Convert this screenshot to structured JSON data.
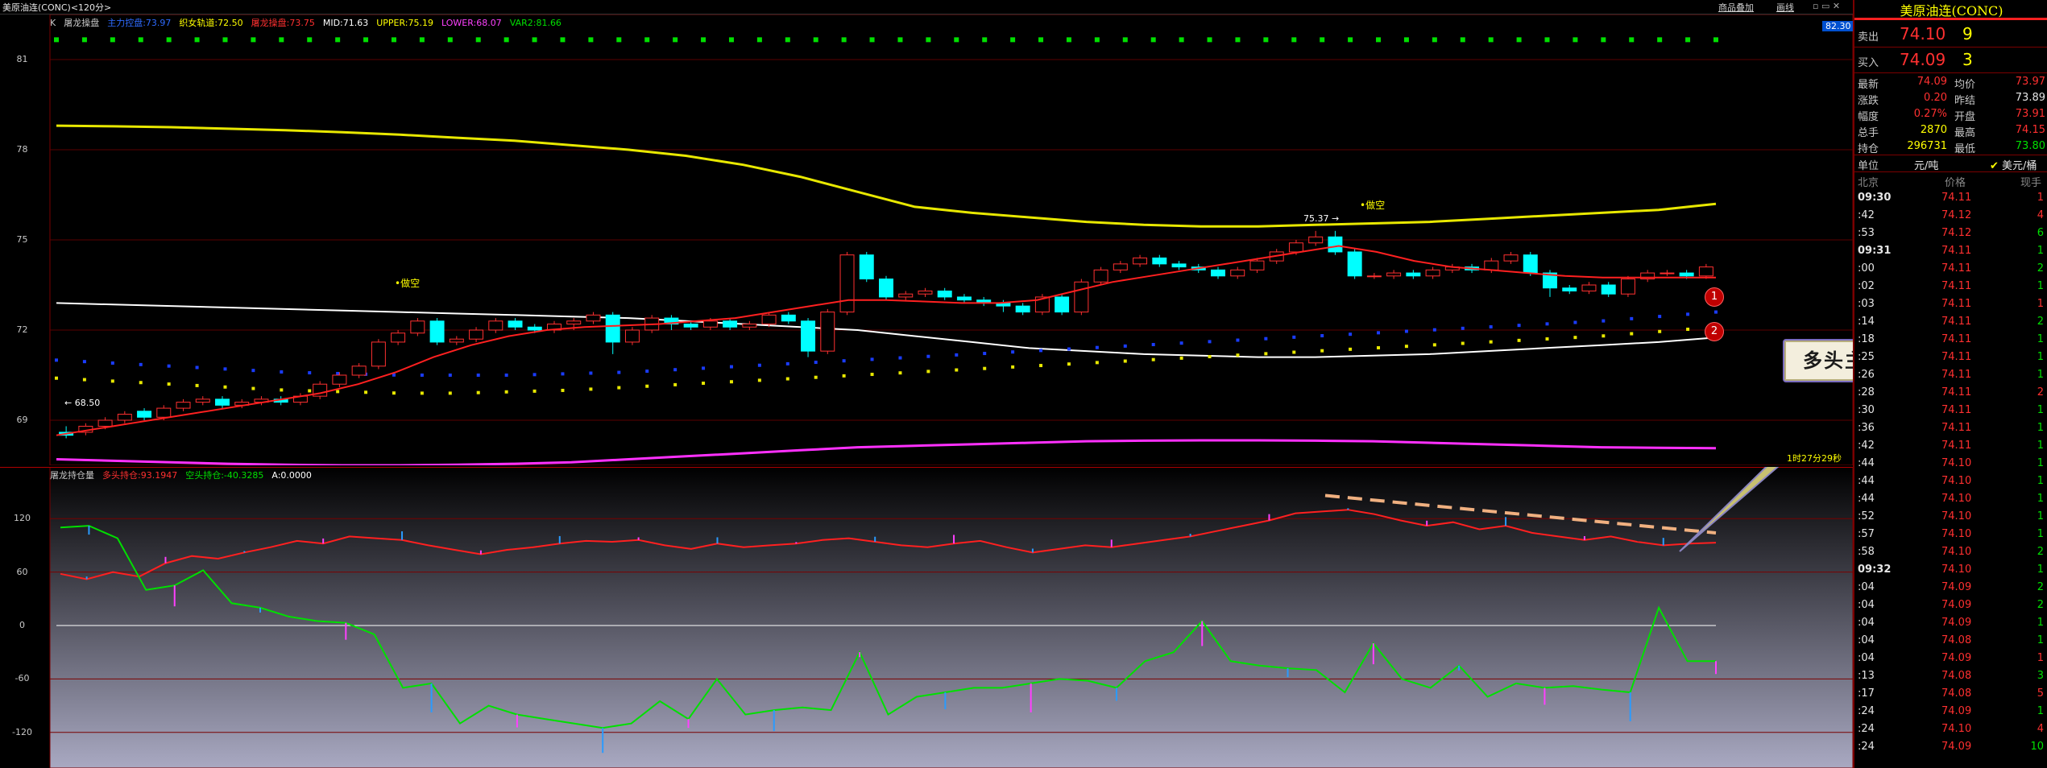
{
  "window": {
    "title": "美原油连(CONC)<120分>",
    "menu": [
      "商品叠加",
      "画线"
    ],
    "timer": "1时27分29秒"
  },
  "main_panel": {
    "legend": [
      {
        "text": "K",
        "color": "#c8c8c8"
      },
      {
        "text": "屠龙操盘",
        "color": "#c8c8c8"
      },
      {
        "text": "主力控盘:73.97",
        "color": "#2e6bff"
      },
      {
        "text": "织女轨道:72.50",
        "color": "#ffff00"
      },
      {
        "text": "屠龙操盘:73.75",
        "color": "#ff3030"
      },
      {
        "text": "MID:71.63",
        "color": "#ffffff"
      },
      {
        "text": "UPPER:75.19",
        "color": "#ffff00"
      },
      {
        "text": "LOWER:68.07",
        "color": "#ff40ff"
      },
      {
        "text": "VAR2:81.66",
        "color": "#00e000"
      }
    ],
    "yticks": [
      "81",
      "78",
      "75",
      "72",
      "69"
    ],
    "price_badge": "82.30",
    "annotations": {
      "high": "75.37",
      "low": "68.50",
      "signal": "做空"
    }
  },
  "sub_panel": {
    "legend": [
      {
        "text": "屠龙持仓量",
        "color": "#c8c8c8"
      },
      {
        "text": "多头持仓:93.1947",
        "color": "#ff3030"
      },
      {
        "text": "空头持仓:-40.3285",
        "color": "#00e000"
      },
      {
        "text": "A:0.0000",
        "color": "#ffffff"
      }
    ],
    "yticks": [
      "120",
      "60",
      "0",
      "-60",
      "-120"
    ]
  },
  "callout": "多头主力拉高出货动作",
  "badges": [
    "1",
    "2"
  ],
  "quote": {
    "title": "美原油连(CONC)",
    "sell_label": "卖出",
    "sell_price": "74.10",
    "sell_vol": "9",
    "buy_label": "买入",
    "buy_price": "74.09",
    "buy_vol": "3",
    "stats": [
      {
        "l1": "最新",
        "v1": "74.09",
        "c1": "red",
        "l2": "均价",
        "v2": "73.97",
        "c2": "red"
      },
      {
        "l1": "涨跌",
        "v1": "0.20",
        "c1": "red",
        "l2": "昨结",
        "v2": "73.89",
        "c2": "wht"
      },
      {
        "l1": "幅度",
        "v1": "0.27%",
        "c1": "red",
        "l2": "开盘",
        "v2": "73.91",
        "c2": "red"
      },
      {
        "l1": "总手",
        "v1": "2870",
        "c1": "yel",
        "l2": "最高",
        "v2": "74.15",
        "c2": "red"
      },
      {
        "l1": "持仓",
        "v1": "296731",
        "c1": "yel",
        "l2": "最低",
        "v2": "73.80",
        "c2": "green"
      }
    ],
    "unit_label": "单位",
    "unit_value": "元/吨",
    "unit_option": "美元/桶",
    "tick_headers": [
      "北京",
      "价格",
      "现手"
    ],
    "ticks": [
      {
        "t": "09:30",
        "p": "74.11",
        "v": "1",
        "pc": "red",
        "vc": "red"
      },
      {
        "t": ":42",
        "p": "74.12",
        "v": "4",
        "pc": "red",
        "vc": "red"
      },
      {
        "t": ":53",
        "p": "74.12",
        "v": "6",
        "pc": "red",
        "vc": "green"
      },
      {
        "t": "09:31",
        "p": "74.11",
        "v": "1",
        "pc": "red",
        "vc": "green"
      },
      {
        "t": ":00",
        "p": "74.11",
        "v": "2",
        "pc": "red",
        "vc": "green"
      },
      {
        "t": ":02",
        "p": "74.11",
        "v": "1",
        "pc": "red",
        "vc": "green"
      },
      {
        "t": ":03",
        "p": "74.11",
        "v": "1",
        "pc": "red",
        "vc": "red"
      },
      {
        "t": ":14",
        "p": "74.11",
        "v": "2",
        "pc": "red",
        "vc": "green"
      },
      {
        "t": ":18",
        "p": "74.11",
        "v": "1",
        "pc": "red",
        "vc": "green"
      },
      {
        "t": ":25",
        "p": "74.11",
        "v": "1",
        "pc": "red",
        "vc": "green"
      },
      {
        "t": ":26",
        "p": "74.11",
        "v": "1",
        "pc": "red",
        "vc": "green"
      },
      {
        "t": ":28",
        "p": "74.11",
        "v": "2",
        "pc": "red",
        "vc": "red"
      },
      {
        "t": ":30",
        "p": "74.11",
        "v": "1",
        "pc": "red",
        "vc": "green"
      },
      {
        "t": ":36",
        "p": "74.11",
        "v": "1",
        "pc": "red",
        "vc": "green"
      },
      {
        "t": ":42",
        "p": "74.11",
        "v": "1",
        "pc": "red",
        "vc": "green"
      },
      {
        "t": ":44",
        "p": "74.10",
        "v": "1",
        "pc": "red",
        "vc": "green"
      },
      {
        "t": ":44",
        "p": "74.10",
        "v": "1",
        "pc": "red",
        "vc": "green"
      },
      {
        "t": ":44",
        "p": "74.10",
        "v": "1",
        "pc": "red",
        "vc": "green"
      },
      {
        "t": ":52",
        "p": "74.10",
        "v": "1",
        "pc": "red",
        "vc": "green"
      },
      {
        "t": ":57",
        "p": "74.10",
        "v": "1",
        "pc": "red",
        "vc": "green"
      },
      {
        "t": ":58",
        "p": "74.10",
        "v": "2",
        "pc": "red",
        "vc": "green"
      },
      {
        "t": "09:32",
        "p": "74.10",
        "v": "1",
        "pc": "red",
        "vc": "green"
      },
      {
        "t": ":04",
        "p": "74.09",
        "v": "2",
        "pc": "red",
        "vc": "green"
      },
      {
        "t": ":04",
        "p": "74.09",
        "v": "2",
        "pc": "red",
        "vc": "green"
      },
      {
        "t": ":04",
        "p": "74.09",
        "v": "1",
        "pc": "red",
        "vc": "green"
      },
      {
        "t": ":04",
        "p": "74.08",
        "v": "1",
        "pc": "red",
        "vc": "green"
      },
      {
        "t": ":04",
        "p": "74.09",
        "v": "1",
        "pc": "red",
        "vc": "red"
      },
      {
        "t": ":13",
        "p": "74.08",
        "v": "3",
        "pc": "red",
        "vc": "green"
      },
      {
        "t": ":17",
        "p": "74.08",
        "v": "5",
        "pc": "red",
        "vc": "red"
      },
      {
        "t": ":24",
        "p": "74.09",
        "v": "1",
        "pc": "red",
        "vc": "green"
      },
      {
        "t": ":24",
        "p": "74.10",
        "v": "4",
        "pc": "red",
        "vc": "red"
      },
      {
        "t": ":24",
        "p": "74.09",
        "v": "10",
        "pc": "red",
        "vc": "green"
      }
    ]
  },
  "colors": {
    "up": "#ff3030",
    "down": "#00ffff",
    "frame": "#7a0000"
  },
  "chart_data": {
    "type": "candlestick",
    "ylim": [
      67.5,
      82.5
    ],
    "candles": [
      [
        68.6,
        68.5,
        68.8,
        68.4
      ],
      [
        68.6,
        68.8,
        68.9,
        68.5
      ],
      [
        68.8,
        69.0,
        69.1,
        68.7
      ],
      [
        69.0,
        69.2,
        69.3,
        68.9
      ],
      [
        69.3,
        69.1,
        69.4,
        69.0
      ],
      [
        69.1,
        69.4,
        69.5,
        69.0
      ],
      [
        69.4,
        69.6,
        69.7,
        69.3
      ],
      [
        69.6,
        69.7,
        69.8,
        69.5
      ],
      [
        69.7,
        69.5,
        69.8,
        69.4
      ],
      [
        69.5,
        69.6,
        69.7,
        69.4
      ],
      [
        69.6,
        69.7,
        69.8,
        69.5
      ],
      [
        69.7,
        69.6,
        69.8,
        69.5
      ],
      [
        69.6,
        69.8,
        69.9,
        69.5
      ],
      [
        69.8,
        70.2,
        70.3,
        69.7
      ],
      [
        70.2,
        70.5,
        70.6,
        70.1
      ],
      [
        70.5,
        70.8,
        70.9,
        70.4
      ],
      [
        70.8,
        71.6,
        71.7,
        70.7
      ],
      [
        71.6,
        71.9,
        72.0,
        71.5
      ],
      [
        71.9,
        72.3,
        72.4,
        71.8
      ],
      [
        72.3,
        71.6,
        72.4,
        71.5
      ],
      [
        71.6,
        71.7,
        71.8,
        71.5
      ],
      [
        71.7,
        72.0,
        72.1,
        71.6
      ],
      [
        72.0,
        72.3,
        72.4,
        71.9
      ],
      [
        72.3,
        72.1,
        72.4,
        72.0
      ],
      [
        72.1,
        72.0,
        72.2,
        71.9
      ],
      [
        72.0,
        72.2,
        72.3,
        71.9
      ],
      [
        72.2,
        72.3,
        72.4,
        72.0
      ],
      [
        72.3,
        72.5,
        72.6,
        72.2
      ],
      [
        72.5,
        71.6,
        72.6,
        71.2
      ],
      [
        71.6,
        72.0,
        72.1,
        71.5
      ],
      [
        72.0,
        72.4,
        72.5,
        71.9
      ],
      [
        72.4,
        72.2,
        72.5,
        72.0
      ],
      [
        72.2,
        72.1,
        72.3,
        72.0
      ],
      [
        72.1,
        72.3,
        72.4,
        72.0
      ],
      [
        72.3,
        72.1,
        72.4,
        72.0
      ],
      [
        72.1,
        72.2,
        72.3,
        72.0
      ],
      [
        72.2,
        72.5,
        72.6,
        72.1
      ],
      [
        72.5,
        72.3,
        72.6,
        72.2
      ],
      [
        72.3,
        71.3,
        72.4,
        71.1
      ],
      [
        71.3,
        72.6,
        72.7,
        71.2
      ],
      [
        72.6,
        74.5,
        74.6,
        72.5
      ],
      [
        74.5,
        73.7,
        74.6,
        73.6
      ],
      [
        73.7,
        73.1,
        73.8,
        73.0
      ],
      [
        73.1,
        73.2,
        73.3,
        73.0
      ],
      [
        73.2,
        73.3,
        73.4,
        73.1
      ],
      [
        73.3,
        73.1,
        73.4,
        73.0
      ],
      [
        73.1,
        73.0,
        73.2,
        72.9
      ],
      [
        73.0,
        72.9,
        73.1,
        72.8
      ],
      [
        72.9,
        72.8,
        73.0,
        72.6
      ],
      [
        72.8,
        72.6,
        72.9,
        72.5
      ],
      [
        72.6,
        73.1,
        73.2,
        72.5
      ],
      [
        73.1,
        72.6,
        73.2,
        72.5
      ],
      [
        72.6,
        73.6,
        73.7,
        72.5
      ],
      [
        73.6,
        74.0,
        74.1,
        73.5
      ],
      [
        74.0,
        74.2,
        74.3,
        73.9
      ],
      [
        74.2,
        74.4,
        74.5,
        74.1
      ],
      [
        74.4,
        74.2,
        74.5,
        74.1
      ],
      [
        74.2,
        74.1,
        74.3,
        74.0
      ],
      [
        74.1,
        74.0,
        74.2,
        73.9
      ],
      [
        74.0,
        73.8,
        74.1,
        73.7
      ],
      [
        73.8,
        74.0,
        74.1,
        73.7
      ],
      [
        74.0,
        74.3,
        74.4,
        73.9
      ],
      [
        74.3,
        74.6,
        74.7,
        74.2
      ],
      [
        74.6,
        74.9,
        75.0,
        74.5
      ],
      [
        74.9,
        75.1,
        75.3,
        74.8
      ],
      [
        75.1,
        74.6,
        75.3,
        74.5
      ],
      [
        74.6,
        73.8,
        74.7,
        73.7
      ],
      [
        73.8,
        73.8,
        73.9,
        73.7
      ],
      [
        73.8,
        73.9,
        74.0,
        73.7
      ],
      [
        73.9,
        73.8,
        74.0,
        73.7
      ],
      [
        73.8,
        74.0,
        74.1,
        73.7
      ],
      [
        74.0,
        74.1,
        74.2,
        73.9
      ],
      [
        74.1,
        74.0,
        74.2,
        73.9
      ],
      [
        74.0,
        74.3,
        74.4,
        73.9
      ],
      [
        74.3,
        74.5,
        74.6,
        74.2
      ],
      [
        74.5,
        73.9,
        74.6,
        73.8
      ],
      [
        73.9,
        73.4,
        74.0,
        73.1
      ],
      [
        73.4,
        73.3,
        73.5,
        73.2
      ],
      [
        73.3,
        73.5,
        73.6,
        73.2
      ],
      [
        73.5,
        73.2,
        73.6,
        73.1
      ],
      [
        73.2,
        73.7,
        73.8,
        73.1
      ],
      [
        73.7,
        73.9,
        74.0,
        73.6
      ],
      [
        73.9,
        73.9,
        74.0,
        73.8
      ],
      [
        73.9,
        73.8,
        74.0,
        73.7
      ],
      [
        73.8,
        74.1,
        74.2,
        73.7
      ]
    ],
    "upper": [
      72.9,
      72.85,
      72.8,
      72.75,
      72.7,
      72.65,
      72.6,
      72.55,
      72.5,
      72.45,
      72.4,
      72.3,
      72.2,
      72.1,
      72.0,
      71.8,
      71.6,
      71.4,
      71.3,
      71.2,
      71.15,
      71.1,
      71.1,
      71.15,
      71.2,
      71.3,
      71.4,
      71.5,
      71.6,
      71.75
    ],
    "mid_line": [
      73.1,
      73.0,
      72.9,
      72.8,
      72.7,
      72.6,
      72.5,
      72.4,
      72.3,
      72.2,
      72.1,
      72.0,
      71.9,
      71.8,
      71.7,
      71.6,
      71.5,
      71.45,
      71.4,
      71.4,
      71.4,
      71.42,
      71.45,
      71.48,
      71.5,
      71.52,
      71.55,
      71.58,
      71.6,
      71.63
    ],
    "yellow_band": [
      78.8,
      78.78,
      78.75,
      78.7,
      78.65,
      78.58,
      78.5,
      78.4,
      78.3,
      78.15,
      78.0,
      77.8,
      77.5,
      77.1,
      76.6,
      76.1,
      75.9,
      75.75,
      75.6,
      75.5,
      75.45,
      75.45,
      75.5,
      75.55,
      75.6,
      75.7,
      75.8,
      75.9,
      76.0,
      76.2
    ],
    "lower_band": [
      67.7,
      67.65,
      67.6,
      67.55,
      67.52,
      67.5,
      67.5,
      67.52,
      67.55,
      67.6,
      67.7,
      67.8,
      67.9,
      68.0,
      68.1,
      68.15,
      68.2,
      68.25,
      68.3,
      68.32,
      68.33,
      68.33,
      68.32,
      68.3,
      68.25,
      68.2,
      68.15,
      68.1,
      68.08,
      68.07
    ],
    "cyan_dots_y": 81.66,
    "blue_dots": [
      71.0,
      70.9,
      70.8,
      70.7,
      70.6,
      70.55,
      70.5,
      70.5,
      70.5,
      70.55,
      70.6,
      70.7,
      70.8,
      70.9,
      71.0,
      71.1,
      71.2,
      71.3,
      71.4,
      71.5,
      71.6,
      71.7,
      71.8,
      71.9,
      72.0,
      72.1,
      72.2,
      72.3,
      72.45,
      72.6
    ],
    "yellow_dots": [
      70.4,
      70.3,
      70.2,
      70.1,
      70.0,
      69.95,
      69.9,
      69.9,
      69.95,
      70.0,
      70.1,
      70.2,
      70.3,
      70.4,
      70.5,
      70.6,
      70.7,
      70.8,
      70.9,
      71.0,
      71.1,
      71.2,
      71.3,
      71.4,
      71.5,
      71.6,
      71.7,
      71.8,
      71.95,
      72.1
    ],
    "red_ma": [
      68.5,
      68.7,
      68.9,
      69.1,
      69.3,
      69.5,
      69.7,
      69.9,
      70.2,
      70.6,
      71.1,
      71.5,
      71.8,
      72.0,
      72.1,
      72.15,
      72.2,
      72.3,
      72.4,
      72.6,
      72.8,
      73.0,
      73.0,
      72.95,
      72.9,
      72.9,
      73.0,
      73.3,
      73.6,
      73.8,
      74.0,
      74.2,
      74.4,
      74.6,
      74.8,
      74.6,
      74.3,
      74.1,
      74.0,
      73.9,
      73.8,
      73.75,
      73.75,
      73.75,
      73.75
    ],
    "long_pos": [
      58,
      52,
      60,
      55,
      70,
      78,
      75,
      82,
      88,
      95,
      92,
      100,
      98,
      96,
      90,
      85,
      80,
      85,
      88,
      92,
      95,
      94,
      96,
      90,
      86,
      92,
      88,
      90,
      92,
      96,
      98,
      94,
      90,
      88,
      92,
      95,
      88,
      82,
      86,
      90,
      88,
      92,
      96,
      100,
      106,
      112,
      118,
      126,
      128,
      130,
      125,
      118,
      112,
      116,
      108,
      112,
      104,
      100,
      96,
      100,
      94,
      90,
      92,
      93
    ],
    "short_pos": [
      110,
      112,
      98,
      40,
      45,
      62,
      25,
      20,
      10,
      5,
      3,
      -10,
      -70,
      -65,
      -110,
      -90,
      -100,
      -105,
      -110,
      -115,
      -110,
      -85,
      -105,
      -60,
      -100,
      -95,
      -92,
      -95,
      -30,
      -100,
      -80,
      -75,
      -70,
      -70,
      -65,
      -60,
      -62,
      -70,
      -40,
      -30,
      5,
      -40,
      -45,
      -48,
      -50,
      -75,
      -20,
      -60,
      -70,
      -45,
      -80,
      -65,
      -70,
      -68,
      -72,
      -75,
      20,
      -40,
      -40
    ],
    "sub_ylim": [
      -160,
      160
    ]
  }
}
